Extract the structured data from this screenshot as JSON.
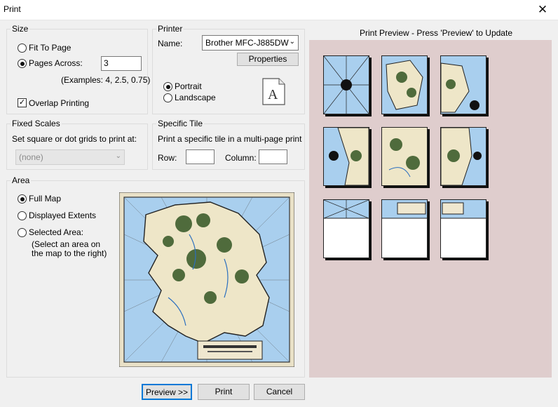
{
  "window": {
    "title": "Print",
    "close_glyph": "✕"
  },
  "size": {
    "legend": "Size",
    "fit_to_page": "Fit To Page",
    "pages_across": "Pages Across:",
    "pages_across_value": "3",
    "examples": "(Examples: 4, 2.5, 0.75)",
    "overlap_printing": "Overlap Printing",
    "selected": "pages_across",
    "overlap_checked": true
  },
  "printer": {
    "legend": "Printer",
    "name_label": "Name:",
    "name_value": "Brother MFC-J885DW",
    "properties_label": "Properties",
    "portrait": "Portrait",
    "landscape": "Landscape",
    "orientation": "portrait",
    "orientation_icon": "page-portrait-icon"
  },
  "fixed_scales": {
    "legend": "Fixed Scales",
    "description": "Set square or dot grids to print at:",
    "value": "(none)"
  },
  "specific_tile": {
    "legend": "Specific Tile",
    "description": "Print a specific tile in a multi-page print",
    "row_label": "Row:",
    "row_value": "",
    "column_label": "Column:",
    "column_value": ""
  },
  "area": {
    "legend": "Area",
    "full_map": "Full Map",
    "displayed_extents": "Displayed Extents",
    "selected_area": "Selected Area:",
    "selected_area_note_1": "(Select an area on",
    "selected_area_note_2": "the map to the right)",
    "selected": "full_map"
  },
  "print_preview": {
    "header": "Print Preview - Press 'Preview' to Update",
    "rows": 3,
    "columns": 3
  },
  "buttons": {
    "preview": "Preview >>",
    "print": "Print",
    "cancel": "Cancel"
  },
  "colors": {
    "preview_bg": "#dfcdcd",
    "sea": "#a9cfee",
    "land": "#e9e1c7",
    "forest": "#4f6b3c",
    "default_button_border": "#0078d7"
  }
}
